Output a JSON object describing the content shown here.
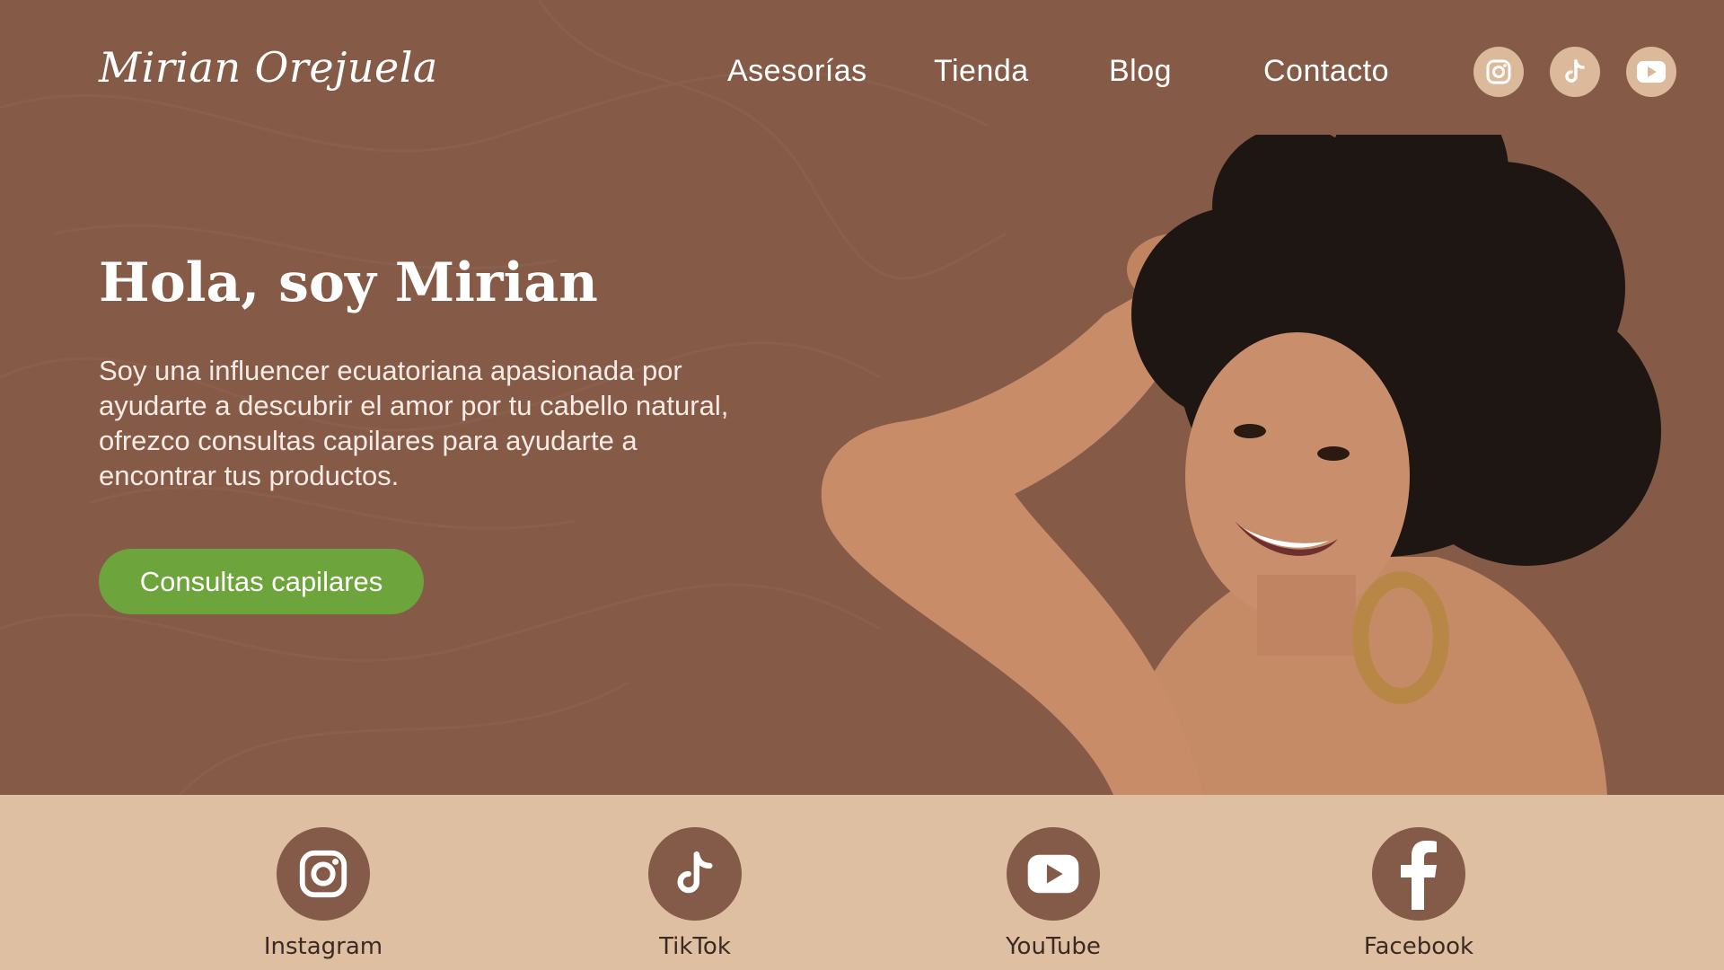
{
  "brand": {
    "logo_text": "Mirian Orejuela"
  },
  "nav": {
    "items": [
      {
        "label": "Asesorías"
      },
      {
        "label": "Tienda"
      },
      {
        "label": "Blog"
      },
      {
        "label": "Contacto"
      }
    ],
    "social_icons": [
      "instagram-icon",
      "tiktok-icon",
      "youtube-icon"
    ]
  },
  "hero": {
    "title": "Hola, soy Mirian",
    "description": "Soy una influencer ecuatoriana apasionada por ayudarte a descubrir el amor por tu cabello natural, ofrezco consultas capilares para ayudarte a encontrar tus productos.",
    "cta_label": "Consultas capilares"
  },
  "social_bar": {
    "items": [
      {
        "label": "Instagram",
        "icon": "instagram-icon"
      },
      {
        "label": "TikTok",
        "icon": "tiktok-icon"
      },
      {
        "label": "YouTube",
        "icon": "youtube-icon"
      },
      {
        "label": "Facebook",
        "icon": "facebook-icon"
      }
    ]
  },
  "colors": {
    "hero_background": "#855b48",
    "cta_green": "#6da43b",
    "social_bar_background": "#dfbfa2",
    "icon_circle_dark": "#845a48",
    "icon_circle_light": "#dcb99a"
  }
}
